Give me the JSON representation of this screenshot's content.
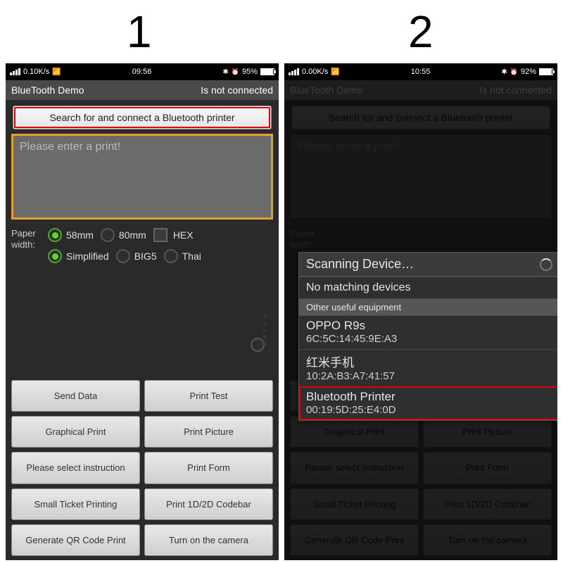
{
  "steps": {
    "one": "1",
    "two": "2"
  },
  "status": {
    "s1": {
      "net": "0.10K/s",
      "time": "09:56",
      "battery_pct": "95%"
    },
    "s2": {
      "net": "0.00K/s",
      "time": "10:55",
      "battery_pct": "92%"
    }
  },
  "title": {
    "app": "BlueTooth Demo",
    "state": "Is not connected"
  },
  "search_button": "Search for and connect a Bluetooth printer",
  "printbox_placeholder": "Please enter a print!",
  "paper_width_label": "Paper\nwidth:",
  "paper_opts": {
    "a": "58mm",
    "b": "80mm",
    "hex": "HEX"
  },
  "enc_opts": {
    "a": "Simplified",
    "b": "BIG5",
    "c": "Thai"
  },
  "side_hint": "K\nc\nn\ne\na",
  "buttons": {
    "r0c0": "Send Data",
    "r0c1": "Print Test",
    "r1c0": "Graphical Print",
    "r1c1": "Print Picture",
    "r2c0": "Please select instruction",
    "r2c1": "Print Form",
    "r3c0": "Small Ticket Printing",
    "r3c1": "Print 1D/2D Codebar",
    "r4c0": "Generate QR Code Print",
    "r4c1": "Turn on the camera"
  },
  "dialog": {
    "title": "Scanning Device…",
    "no_match": "No matching devices",
    "other": "Other useful equipment",
    "devices": [
      {
        "name": "OPPO R9s",
        "mac": "6C:5C:14:45:9E:A3"
      },
      {
        "name": "红米手机",
        "mac": "10:2A:B3:A7:41:57"
      },
      {
        "name": "Bluetooth Printer",
        "mac": "00:19:5D:25:E4:0D"
      }
    ]
  }
}
